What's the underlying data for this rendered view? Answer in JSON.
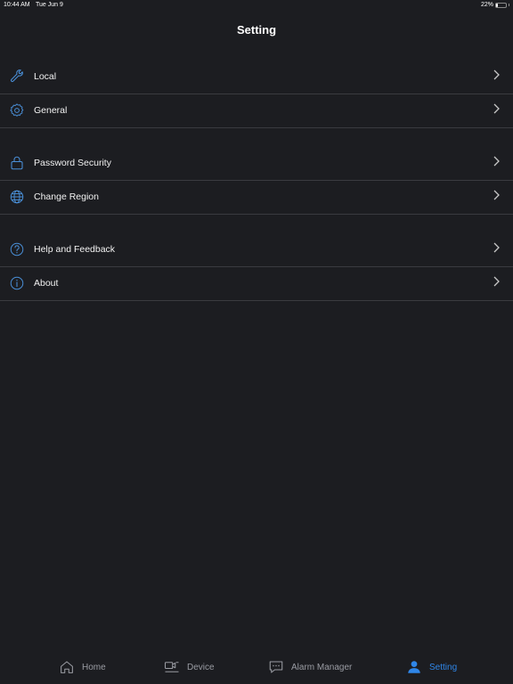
{
  "status_bar": {
    "time": "10:44 AM",
    "date": "Tue Jun 9",
    "battery": "22%",
    "battery_level": 0.22
  },
  "header": {
    "title": "Setting"
  },
  "groups": [
    {
      "items": [
        {
          "label": "Local",
          "icon": "wrench-icon"
        },
        {
          "label": "General",
          "icon": "gear-icon"
        }
      ]
    },
    {
      "items": [
        {
          "label": "Password Security",
          "icon": "lock-icon"
        },
        {
          "label": "Change Region",
          "icon": "globe-icon"
        }
      ]
    },
    {
      "items": [
        {
          "label": "Help and Feedback",
          "icon": "help-circle-icon"
        },
        {
          "label": "About",
          "icon": "info-circle-icon"
        }
      ]
    }
  ],
  "tabs": [
    {
      "label": "Home",
      "icon": "home-icon",
      "active": false
    },
    {
      "label": "Device",
      "icon": "camera-icon",
      "active": false
    },
    {
      "label": "Alarm Manager",
      "icon": "message-icon",
      "active": false
    },
    {
      "label": "Setting",
      "icon": "person-icon",
      "active": true
    }
  ],
  "colors": {
    "background": "#1c1d21",
    "accent": "#2f86e8",
    "icon": "#4a90d9",
    "divider": "#3a3b40",
    "inactive_tab": "#9a9ca3"
  }
}
